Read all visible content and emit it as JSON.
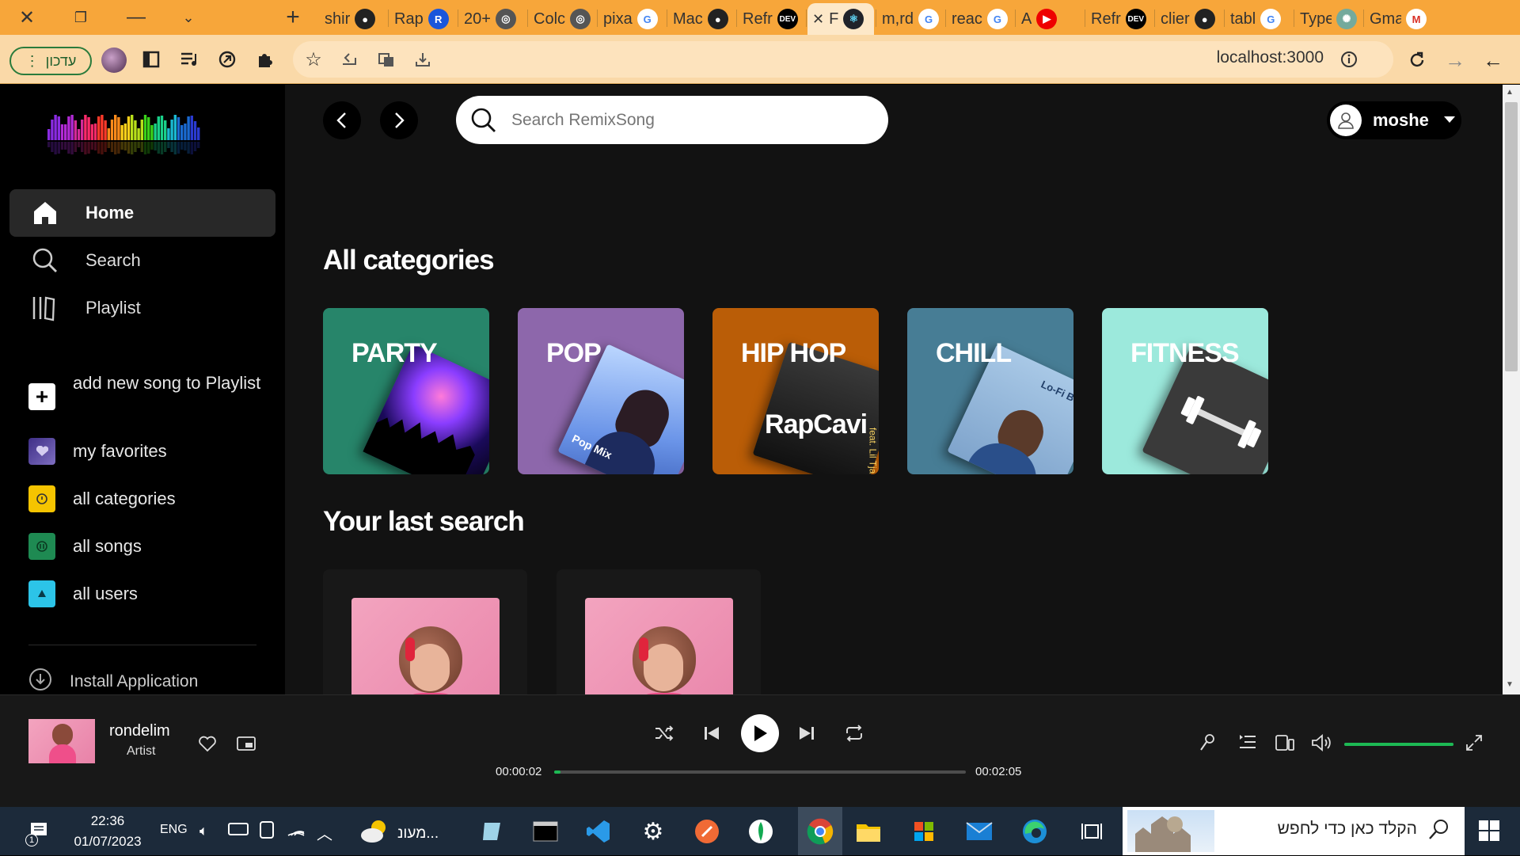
{
  "browser": {
    "tabs": [
      {
        "label": "shir",
        "favicon": "github-icon"
      },
      {
        "label": "Rap",
        "favicon": "rapidapi-icon"
      },
      {
        "label": "20+",
        "favicon": "generic-icon"
      },
      {
        "label": "Colc",
        "favicon": "generic-icon"
      },
      {
        "label": "pixa",
        "favicon": "google-icon"
      },
      {
        "label": "Mac",
        "favicon": "github-icon"
      },
      {
        "label": "Refr",
        "favicon": "dev-icon"
      },
      {
        "label": "F",
        "favicon": "react-icon"
      },
      {
        "label": "m,rd",
        "favicon": "google-icon"
      },
      {
        "label": "reac",
        "favicon": "google-icon"
      },
      {
        "label": "A",
        "favicon": "youtube-icon"
      },
      {
        "label": "Refr",
        "favicon": "dev-icon"
      },
      {
        "label": "clier",
        "favicon": "github-icon"
      },
      {
        "label": "tabl",
        "favicon": "google-icon"
      },
      {
        "label": "Type",
        "favicon": "chatgpt-icon"
      },
      {
        "label": "Gma",
        "favicon": "gmail-icon"
      }
    ],
    "update_button": "עדכון",
    "url": "localhost:3000"
  },
  "app": {
    "search_placeholder": "Search RemixSong",
    "user_name": "moshe",
    "nav": [
      {
        "label": "Home",
        "icon": "home-icon",
        "active": true
      },
      {
        "label": "Search",
        "icon": "search-icon",
        "active": false
      },
      {
        "label": "Playlist",
        "icon": "library-icon",
        "active": false
      }
    ],
    "library": [
      {
        "label": "add new song to Playlist",
        "icon": "plus-icon",
        "color": "#ffffff"
      },
      {
        "label": "my favorites",
        "icon": "heart-icon",
        "color": "#4b3a8c"
      },
      {
        "label": "all categories",
        "icon": "category-icon",
        "color": "#f5c400"
      },
      {
        "label": "all songs",
        "icon": "music-icon",
        "color": "#1e8a52"
      },
      {
        "label": "all users",
        "icon": "user-icon",
        "color": "#2cc4e8"
      }
    ],
    "install_label": "Install Application",
    "categories_title": "All categories",
    "categories": [
      {
        "label": "PARTY",
        "color": "#27856a"
      },
      {
        "label": "POP",
        "color": "#8d67ab"
      },
      {
        "label": "HIP HOP",
        "color": "#ba5d07",
        "art_text": "RapCavi",
        "art_sub": "feat. Lil Tja & Glak"
      },
      {
        "label": "CHILL",
        "color": "#477d95",
        "art_text": "Lo-Fi Beats"
      },
      {
        "label": "FITNESS",
        "color": "#9ce9dc"
      }
    ],
    "pop_art_text": "Pop Mix",
    "last_search_title": "Your last search"
  },
  "player": {
    "song_title": "rondelim",
    "artist": "Artist",
    "elapsed": "00:00:02",
    "duration": "00:02:05",
    "progress": 0.016,
    "volume": 1.0,
    "accent": "#1db954"
  },
  "taskbar": {
    "time": "22:36",
    "date": "01/07/2023",
    "lang": "ENG",
    "notification_badge": "1",
    "weather_label": "מעונ...",
    "search_placeholder": "הקלד כאן כדי לחפש"
  }
}
